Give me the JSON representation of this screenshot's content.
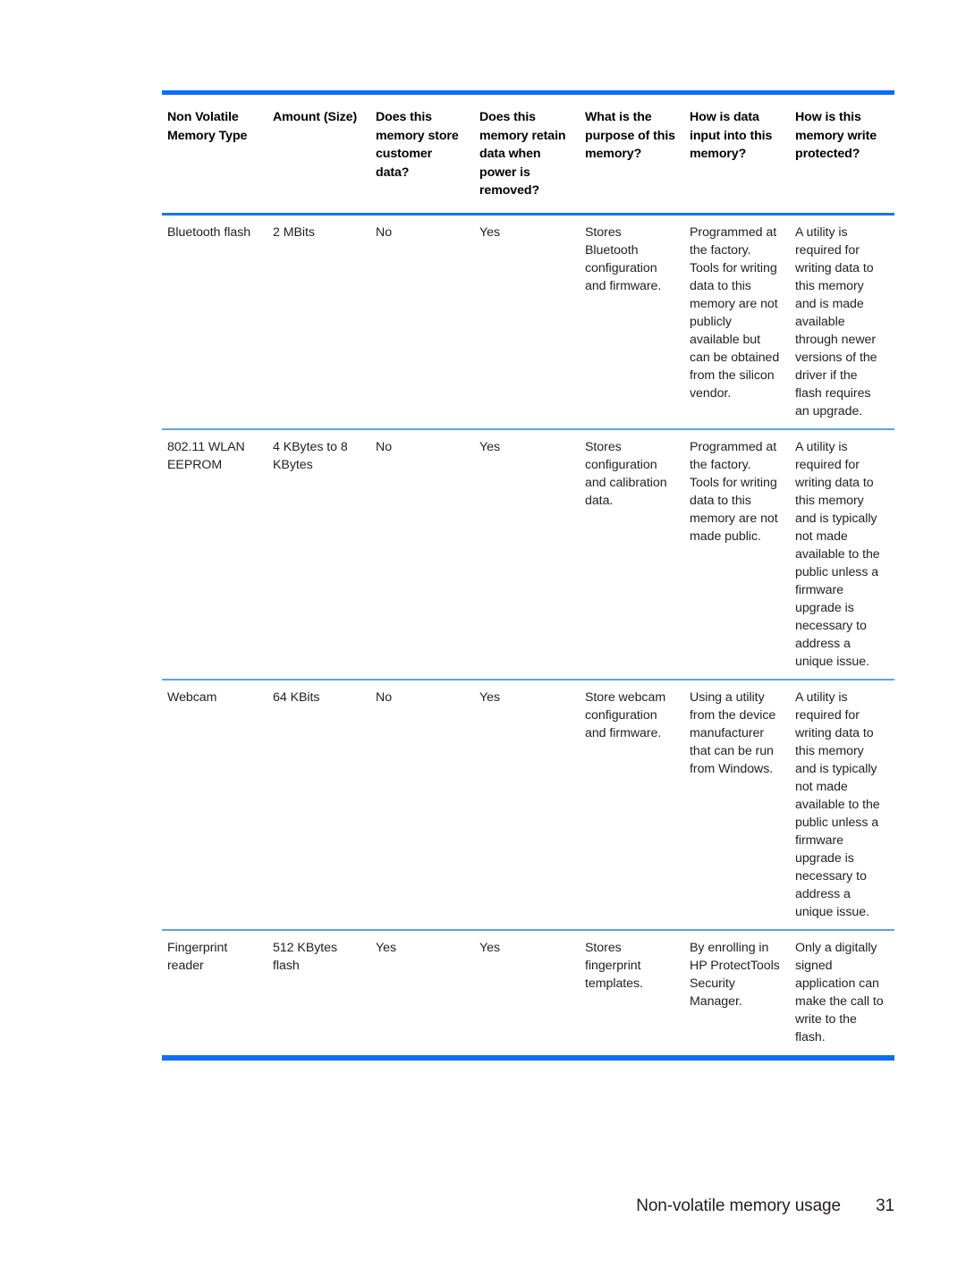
{
  "document": {
    "footer": {
      "section_title": "Non-volatile memory usage",
      "page_number": "31"
    },
    "accent_colors": {
      "rule_strong": "#0d6ef5",
      "rule_header": "#1b74ee",
      "rule_row": "#5ea3e0"
    }
  },
  "table": {
    "columns": [
      "Non Volatile Memory Type",
      "Amount (Size)",
      "Does this memory store customer data?",
      "Does this memory retain data when power is removed?",
      "What is the purpose of this memory?",
      "How is data input into this memory?",
      "How is this memory write protected?"
    ],
    "rows": [
      {
        "type": "Bluetooth flash",
        "size": "2 MBits",
        "stores_customer_data": "No",
        "retains_data": "Yes",
        "purpose": "Stores Bluetooth configuration and firmware.",
        "data_input": "Programmed at the factory. Tools for writing data to this memory are not publicly available but can be obtained from the silicon vendor.",
        "write_protected": "A utility is required for writing data to this memory and is made available through newer versions of the driver if the flash requires an upgrade."
      },
      {
        "type": "802.11 WLAN EEPROM",
        "size": "4 KBytes to 8 KBytes",
        "stores_customer_data": "No",
        "retains_data": "Yes",
        "purpose": "Stores configuration and calibration data.",
        "data_input": "Programmed at the factory. Tools for writing data to this memory are not made public.",
        "write_protected": "A utility is required for writing data to this memory and is typically not made available to the public unless a firmware upgrade is necessary to address a unique issue."
      },
      {
        "type": "Webcam",
        "size": "64 KBits",
        "stores_customer_data": "No",
        "retains_data": "Yes",
        "purpose": "Store webcam configuration and firmware.",
        "data_input": "Using a utility from the device manufacturer that can be run from Windows.",
        "write_protected": "A utility is required for writing data to this memory and is typically not made available to the public unless a firmware upgrade is necessary to address a unique issue."
      },
      {
        "type": "Fingerprint reader",
        "size": "512 KBytes flash",
        "stores_customer_data": "Yes",
        "retains_data": "Yes",
        "purpose": "Stores fingerprint templates.",
        "data_input": "By enrolling in HP ProtectTools Security Manager.",
        "write_protected": "Only a digitally signed application can make the call to write to the flash."
      }
    ]
  }
}
